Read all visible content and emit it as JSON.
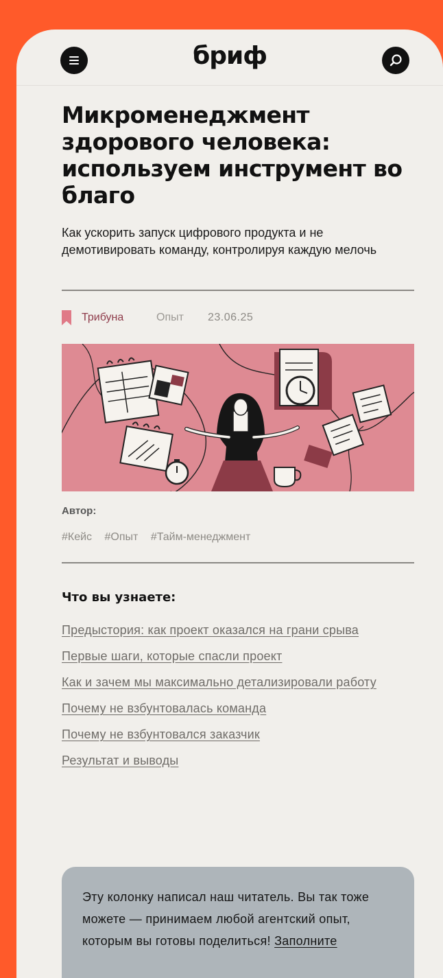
{
  "header": {
    "logo": "бриф",
    "menu_icon": "hamburger-menu-icon",
    "search_icon": "search-icon"
  },
  "article": {
    "title": "Микроменеджмент здорового человека: используем инструмент во благо",
    "lead": "Как ускорить запуск цифрового продукта и не демотивировать команду, контролируя каждую мелочь",
    "meta": {
      "rubric": "Трибуна",
      "type": "Опыт",
      "date": "23.06.25"
    },
    "author_label": "Автор:",
    "tags": [
      "#Кейс",
      "#Опыт",
      "#Тайм-менеджмент"
    ]
  },
  "toc": {
    "title": "Что вы узнаете:",
    "items": [
      "Предыстория: как проект оказался на грани срыва",
      "Первые шаги, которые спасли проект",
      "Как и зачем мы максимально детализировали работу",
      "Почему не взбунтовалась команда",
      "Почему не взбунтовался заказчик",
      "Результат и выводы"
    ]
  },
  "callout": {
    "text": "Эту колонку написал наш читатель. Вы так тоже можете — принимаем любой агентский опыт, которым вы готовы поделиться! ",
    "link": "Заполните"
  },
  "colors": {
    "frame": "#FF5A2A",
    "page": "#F1EFEB",
    "hero_bg": "#DE8A93",
    "rubric": "#8E3B4A",
    "bookmark": "#E07A87",
    "callout_bg": "#AEB5BA"
  }
}
